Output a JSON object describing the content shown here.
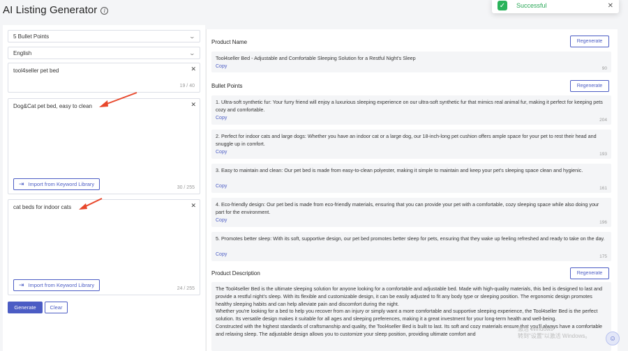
{
  "header": {
    "title": "AI Listing Generator"
  },
  "toast": {
    "message": "Successful"
  },
  "left": {
    "bullet_select": "5 Bullet Points",
    "language_select": "English",
    "title_input": {
      "value": "tool4seller pet bed",
      "count": "19 / 40"
    },
    "keywords_1": {
      "value": "Dog&Cat pet bed, easy to clean",
      "count": "30 / 255",
      "import_label": "Import from Keyword Library"
    },
    "keywords_2": {
      "value": "cat beds for indoor cats",
      "count": "24 / 255",
      "import_label": "Import from Keyword Library"
    },
    "generate_label": "Generate",
    "clear_label": "Clear"
  },
  "right": {
    "copy_label": "Copy",
    "regenerate_label": "Regenerate",
    "product_name": {
      "title": "Product Name",
      "text": "Tool4seller Bed - Adjustable and Comfortable Sleeping Solution for a Restful Night's Sleep",
      "count": "90"
    },
    "bullet_points": {
      "title": "Bullet Points",
      "items": [
        {
          "text": "1. Ultra-soft synthetic fur: Your furry friend will enjoy a luxurious sleeping experience on our ultra-soft synthetic fur that mimics real animal fur, making it perfect for keeping pets cozy and comfortable.",
          "count": "204"
        },
        {
          "text": "2. Perfect for indoor cats and large dogs: Whether you have an indoor cat or a large dog, our 18-inch-long pet cushion offers ample space for your pet to rest their head and snuggle up in comfort.",
          "count": "193"
        },
        {
          "text": "3. Easy to maintain and clean: Our pet bed is made from easy-to-clean polyester, making it simple to maintain and keep your pet's sleeping space clean and hygienic.",
          "count": "161"
        },
        {
          "text": "4. Eco-friendly design: Our pet bed is made from eco-friendly materials, ensuring that you can provide your pet with a comfortable, cozy sleeping space while also doing your part for the environment.",
          "count": "196"
        },
        {
          "text": "5. Promotes better sleep: With its soft, supportive design, our pet bed promotes better sleep for pets, ensuring that they wake up feeling refreshed and ready to take on the day.",
          "count": "175"
        }
      ]
    },
    "description": {
      "title": "Product Description",
      "paragraphs": [
        "The Tool4seller Bed is the ultimate sleeping solution for anyone looking for a comfortable and adjustable bed. Made with high-quality materials, this bed is designed to last and provide a restful night's sleep. With its flexible and customizable design, it can be easily adjusted to fit any body type or sleeping position. The ergonomic design promotes healthy sleeping habits and can help alleviate pain and discomfort during the night.",
        "Whether you're looking for a bed to help you recover from an injury or simply want a more comfortable and supportive sleeping experience, the Tool4seller Bed is the perfect solution. Its versatile design makes it suitable for all ages and sleeping preferences, making it a great investment for your long-term health and well-being.",
        "Constructed with the highest standards of craftsmanship and quality, the Tool4seller Bed is built to last. Its soft and cozy materials ensure that you'll always have a comfortable and relaxing sleep. The adjustable design allows you to customize your sleep position, providing ultimate comfort and"
      ]
    }
  },
  "overlay": {
    "watermark_line1": "激活 Windows",
    "watermark_line2": "转到\"设置\"以激活 Windows。"
  },
  "colors": {
    "accent": "#4b5cc4",
    "success": "#29b35a",
    "arrow": "#e8472b",
    "card_bg": "#f4f5f7"
  }
}
